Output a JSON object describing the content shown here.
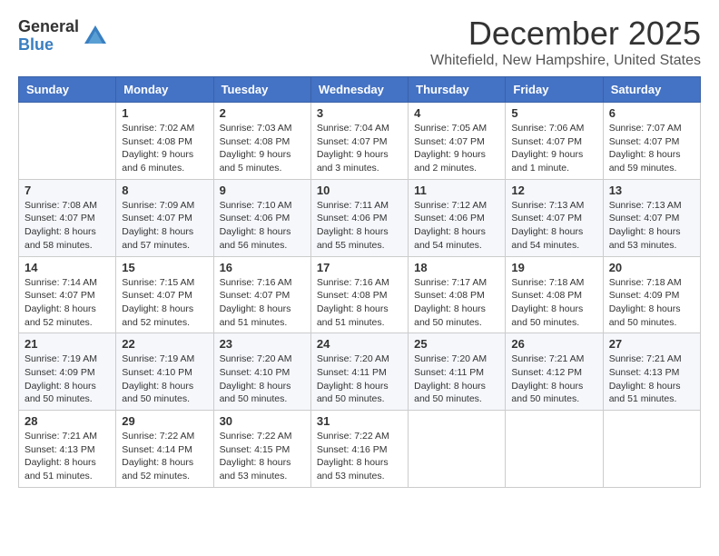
{
  "header": {
    "logo_general": "General",
    "logo_blue": "Blue",
    "month": "December 2025",
    "location": "Whitefield, New Hampshire, United States"
  },
  "weekdays": [
    "Sunday",
    "Monday",
    "Tuesday",
    "Wednesday",
    "Thursday",
    "Friday",
    "Saturday"
  ],
  "weeks": [
    [
      {
        "day": "",
        "info": ""
      },
      {
        "day": "1",
        "info": "Sunrise: 7:02 AM\nSunset: 4:08 PM\nDaylight: 9 hours\nand 6 minutes."
      },
      {
        "day": "2",
        "info": "Sunrise: 7:03 AM\nSunset: 4:08 PM\nDaylight: 9 hours\nand 5 minutes."
      },
      {
        "day": "3",
        "info": "Sunrise: 7:04 AM\nSunset: 4:07 PM\nDaylight: 9 hours\nand 3 minutes."
      },
      {
        "day": "4",
        "info": "Sunrise: 7:05 AM\nSunset: 4:07 PM\nDaylight: 9 hours\nand 2 minutes."
      },
      {
        "day": "5",
        "info": "Sunrise: 7:06 AM\nSunset: 4:07 PM\nDaylight: 9 hours\nand 1 minute."
      },
      {
        "day": "6",
        "info": "Sunrise: 7:07 AM\nSunset: 4:07 PM\nDaylight: 8 hours\nand 59 minutes."
      }
    ],
    [
      {
        "day": "7",
        "info": "Sunrise: 7:08 AM\nSunset: 4:07 PM\nDaylight: 8 hours\nand 58 minutes."
      },
      {
        "day": "8",
        "info": "Sunrise: 7:09 AM\nSunset: 4:07 PM\nDaylight: 8 hours\nand 57 minutes."
      },
      {
        "day": "9",
        "info": "Sunrise: 7:10 AM\nSunset: 4:06 PM\nDaylight: 8 hours\nand 56 minutes."
      },
      {
        "day": "10",
        "info": "Sunrise: 7:11 AM\nSunset: 4:06 PM\nDaylight: 8 hours\nand 55 minutes."
      },
      {
        "day": "11",
        "info": "Sunrise: 7:12 AM\nSunset: 4:06 PM\nDaylight: 8 hours\nand 54 minutes."
      },
      {
        "day": "12",
        "info": "Sunrise: 7:13 AM\nSunset: 4:07 PM\nDaylight: 8 hours\nand 54 minutes."
      },
      {
        "day": "13",
        "info": "Sunrise: 7:13 AM\nSunset: 4:07 PM\nDaylight: 8 hours\nand 53 minutes."
      }
    ],
    [
      {
        "day": "14",
        "info": "Sunrise: 7:14 AM\nSunset: 4:07 PM\nDaylight: 8 hours\nand 52 minutes."
      },
      {
        "day": "15",
        "info": "Sunrise: 7:15 AM\nSunset: 4:07 PM\nDaylight: 8 hours\nand 52 minutes."
      },
      {
        "day": "16",
        "info": "Sunrise: 7:16 AM\nSunset: 4:07 PM\nDaylight: 8 hours\nand 51 minutes."
      },
      {
        "day": "17",
        "info": "Sunrise: 7:16 AM\nSunset: 4:08 PM\nDaylight: 8 hours\nand 51 minutes."
      },
      {
        "day": "18",
        "info": "Sunrise: 7:17 AM\nSunset: 4:08 PM\nDaylight: 8 hours\nand 50 minutes."
      },
      {
        "day": "19",
        "info": "Sunrise: 7:18 AM\nSunset: 4:08 PM\nDaylight: 8 hours\nand 50 minutes."
      },
      {
        "day": "20",
        "info": "Sunrise: 7:18 AM\nSunset: 4:09 PM\nDaylight: 8 hours\nand 50 minutes."
      }
    ],
    [
      {
        "day": "21",
        "info": "Sunrise: 7:19 AM\nSunset: 4:09 PM\nDaylight: 8 hours\nand 50 minutes."
      },
      {
        "day": "22",
        "info": "Sunrise: 7:19 AM\nSunset: 4:10 PM\nDaylight: 8 hours\nand 50 minutes."
      },
      {
        "day": "23",
        "info": "Sunrise: 7:20 AM\nSunset: 4:10 PM\nDaylight: 8 hours\nand 50 minutes."
      },
      {
        "day": "24",
        "info": "Sunrise: 7:20 AM\nSunset: 4:11 PM\nDaylight: 8 hours\nand 50 minutes."
      },
      {
        "day": "25",
        "info": "Sunrise: 7:20 AM\nSunset: 4:11 PM\nDaylight: 8 hours\nand 50 minutes."
      },
      {
        "day": "26",
        "info": "Sunrise: 7:21 AM\nSunset: 4:12 PM\nDaylight: 8 hours\nand 50 minutes."
      },
      {
        "day": "27",
        "info": "Sunrise: 7:21 AM\nSunset: 4:13 PM\nDaylight: 8 hours\nand 51 minutes."
      }
    ],
    [
      {
        "day": "28",
        "info": "Sunrise: 7:21 AM\nSunset: 4:13 PM\nDaylight: 8 hours\nand 51 minutes."
      },
      {
        "day": "29",
        "info": "Sunrise: 7:22 AM\nSunset: 4:14 PM\nDaylight: 8 hours\nand 52 minutes."
      },
      {
        "day": "30",
        "info": "Sunrise: 7:22 AM\nSunset: 4:15 PM\nDaylight: 8 hours\nand 53 minutes."
      },
      {
        "day": "31",
        "info": "Sunrise: 7:22 AM\nSunset: 4:16 PM\nDaylight: 8 hours\nand 53 minutes."
      },
      {
        "day": "",
        "info": ""
      },
      {
        "day": "",
        "info": ""
      },
      {
        "day": "",
        "info": ""
      }
    ]
  ]
}
